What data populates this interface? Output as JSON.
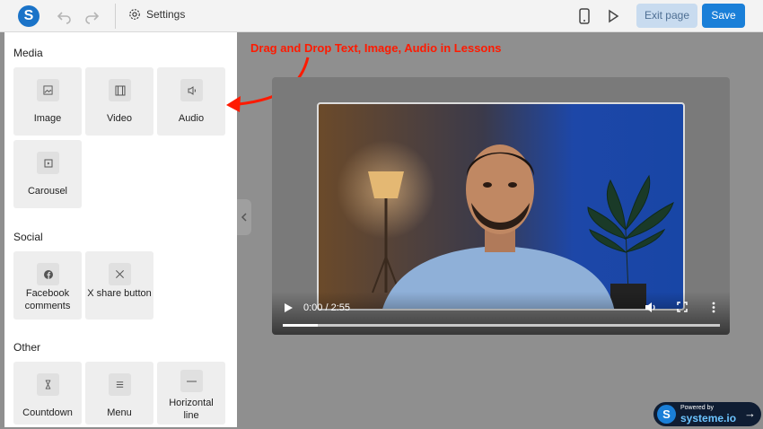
{
  "topbar": {
    "logo_letter": "S",
    "settings_label": "Settings",
    "exit_label": "Exit page",
    "save_label": "Save"
  },
  "panel": {
    "sections": [
      {
        "title": "Media",
        "items": [
          "Image",
          "Video",
          "Audio",
          "Carousel"
        ]
      },
      {
        "title": "Social",
        "items": [
          "Facebook comments",
          "X share button"
        ]
      },
      {
        "title": "Other",
        "items": [
          "Countdown",
          "Menu",
          "Horizontal line"
        ]
      }
    ]
  },
  "annotation": {
    "text": "Drag and Drop Text, Image, Audio in Lessons",
    "color": "#ff1a00"
  },
  "video": {
    "time": "0:00 / 2:55",
    "progress": 0.08
  },
  "badge": {
    "small": "Powered by",
    "brand": "systeme.io",
    "letter": "S"
  },
  "colors": {
    "primary": "#1a7fd8",
    "exit_bg": "#c8dbef"
  }
}
